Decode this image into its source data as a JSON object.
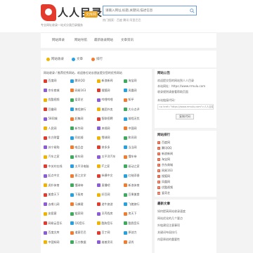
{
  "header": {
    "logo_text": "人人目录",
    "logo_badge": "文库网",
    "slogan": "专业网址收录一站式分类目录服务",
    "search_placeholder": "请输入网址,标题,关键词,描述信息",
    "hot": "热门搜索：百度 腾讯 阿里巴巴"
  },
  "nav": [
    "网站目录",
    "网站导航",
    "最新收录网站",
    "文章资讯"
  ],
  "quick": [
    {
      "label": "网站收录",
      "color": "#f0b400"
    },
    {
      "label": "文章",
      "color": "#27a0e0"
    },
    {
      "label": "排行",
      "color": "#f17c2f"
    }
  ],
  "main": {
    "heading": "网站收录 / 推荐优秀网站，欢迎各位站长朋友提交您的优秀网站",
    "sites": [
      "百度网",
      "腾讯QQ",
      "新浪新闻",
      "淘宝网",
      "京东商城",
      "网易163",
      "搜狐网",
      "凤凰网",
      "优酷视频",
      "爱奇艺",
      "哔哩哔哩",
      "知乎",
      "豆瓣网",
      "携程旅行",
      "美团外卖",
      "大众点评",
      "58同城",
      "赶集网",
      "智联招聘",
      "前程无忧",
      "人民网",
      "新华网",
      "央视网",
      "中国网",
      "东方财富",
      "同花顺",
      "雪球网",
      "和讯网",
      "苏宁易购",
      "唯品会",
      "拼多多",
      "当当网",
      "汽车之家",
      "易车网",
      "太平洋汽车",
      "懂车帝",
      "中关村在线",
      "太平洋电脑",
      "IT之家",
      "驱动之家",
      "起点中文",
      "晋江文学",
      "纵横中文",
      "红袖添香",
      "虎扑体育",
      "懂球帝",
      "直播吧",
      "新浪体育",
      "美食天下",
      "下厨房",
      "好豆网",
      "豆果美食",
      "去哪儿网",
      "马蜂窝",
      "途牛旅游",
      "飞猪旅行",
      "安居客",
      "链家网",
      "贝壳找房",
      "房天下",
      "网易云音乐",
      "QQ音乐",
      "酷狗音乐",
      "酷我音乐",
      "百度文库",
      "道客巴巴",
      "豆丁网",
      "原创力",
      "中国知网",
      "万方数据",
      "维普资讯",
      "读秀"
    ]
  },
  "sidebar": {
    "notice_title": "网站公告",
    "notice_lines": [
      "欢迎提交您的网站到人人目录",
      "本站网址：https://www.rrmulu.com",
      "收录规则请查看帮助页面"
    ],
    "code_label": "本站链接代码：",
    "code": "<a href=\"https://www.rrmulu.com\">人人目录</a>",
    "copy_label": "复制代码",
    "ranking_title": "网站排行",
    "ranking": [
      "百度网",
      "腾讯QQ",
      "新浪新闻",
      "淘宝网",
      "京东商城",
      "网易163",
      "搜狐网",
      "凤凰网",
      "优酷视频",
      "爱奇艺"
    ],
    "news_title": "最新文章",
    "news": [
      "如何提高网站收录速度",
      "网站优化的几个要点",
      "外链建设注意事项",
      "关键词布局技巧",
      "内容原创的重要性"
    ]
  },
  "colors": {
    "accent": "#e23b2e",
    "search_border": "#6b9bd2"
  }
}
